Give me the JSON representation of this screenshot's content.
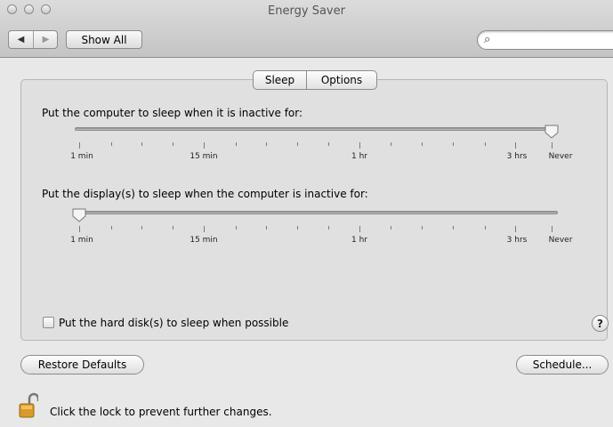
{
  "window": {
    "title": "Energy Saver"
  },
  "toolbar": {
    "show_all_label": "Show All",
    "back_glyph": "◀",
    "forward_glyph": "▶",
    "search_placeholder": "",
    "search_glyph": "⌕"
  },
  "tabs": [
    {
      "label": "Sleep",
      "selected": true
    },
    {
      "label": "Options",
      "selected": false
    }
  ],
  "computer_sleep": {
    "label": "Put the computer to sleep when it is inactive for:",
    "value": "Never",
    "ticks": [
      "1 min",
      "15 min",
      "1 hr",
      "3 hrs",
      "Never"
    ]
  },
  "display_sleep": {
    "label": "Put the display(s) to sleep when the computer is inactive for:",
    "value": "1 min",
    "ticks": [
      "1 min",
      "15 min",
      "1 hr",
      "3 hrs",
      "Never"
    ]
  },
  "hard_disk": {
    "label": "Put the hard disk(s) to sleep when possible",
    "checked": false
  },
  "help": {
    "glyph": "?"
  },
  "buttons": {
    "restore_defaults": "Restore Defaults",
    "schedule": "Schedule..."
  },
  "lock": {
    "text": "Click the lock to prevent further changes."
  }
}
